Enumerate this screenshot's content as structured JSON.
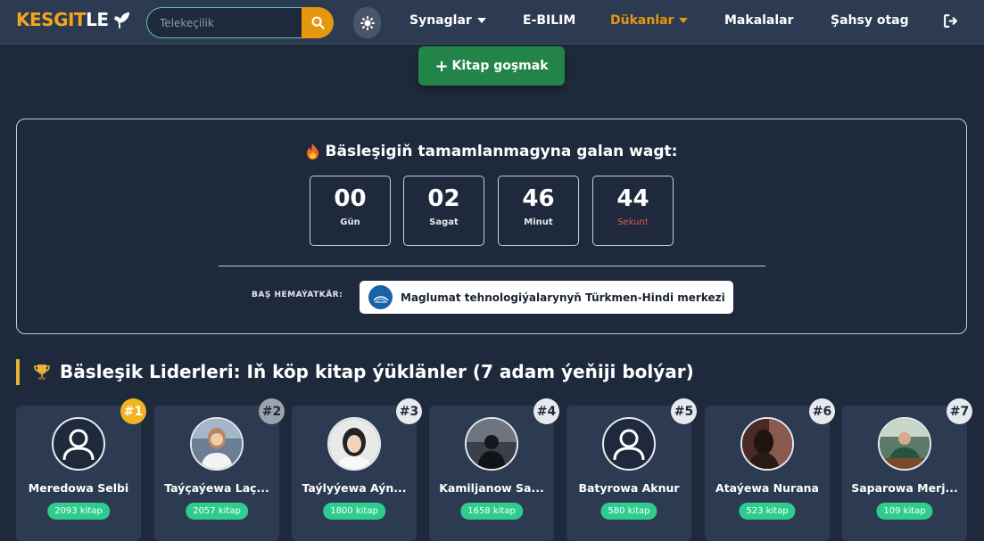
{
  "brand": {
    "part1": "KESGIT",
    "part2": "LE"
  },
  "search": {
    "placeholder": "Telekeçilik"
  },
  "nav": {
    "items": [
      {
        "label": "Synaglar",
        "dropdown": true
      },
      {
        "label": "E-BILIM",
        "dropdown": false
      },
      {
        "label": "Dükanlar",
        "dropdown": true,
        "active": true
      },
      {
        "label": "Makalalar",
        "dropdown": false
      },
      {
        "label": "Şahsy otag",
        "dropdown": false
      }
    ]
  },
  "add_book": {
    "label": "Kitap goşmak"
  },
  "countdown": {
    "title": "Bäsleşigiň tamamlanmagyna galan wagt:",
    "days": {
      "value": "00",
      "unit": "Gün"
    },
    "hours": {
      "value": "02",
      "unit": "Sagat"
    },
    "minutes": {
      "value": "46",
      "unit": "Minut"
    },
    "seconds": {
      "value": "44",
      "unit": "Sekunt"
    }
  },
  "sponsor": {
    "label": "BAŞ HEMAÝATKÄR:",
    "name": "Maglumat tehnologiýalarynyň Türkmen-Hindi merkezi"
  },
  "leaders": {
    "title": "Bäsleşik Liderleri: Iň köp kitap ýüklänler (7 adam ýeňiji bolýar)",
    "cards": [
      {
        "rank": "#1",
        "name": "Meredowa Selbi",
        "count": "2093 kitap",
        "avatar": "default-person"
      },
      {
        "rank": "#2",
        "name": "Taýçaýewa Laç...",
        "count": "2057 kitap",
        "avatar": "photo"
      },
      {
        "rank": "#3",
        "name": "Taýlyýewa Aýn...",
        "count": "1800 kitap",
        "avatar": "photo"
      },
      {
        "rank": "#4",
        "name": "Kamiljanow Sa...",
        "count": "1658 kitap",
        "avatar": "photo"
      },
      {
        "rank": "#5",
        "name": "Batyrowa Aknur",
        "count": "580 kitap",
        "avatar": "default-person"
      },
      {
        "rank": "#6",
        "name": "Ataýewa Nurana",
        "count": "523 kitap",
        "avatar": "photo"
      },
      {
        "rank": "#7",
        "name": "Saparowa Merj...",
        "count": "109 kitap",
        "avatar": "photo"
      }
    ]
  },
  "colors": {
    "accent_orange": "#e7970f",
    "green_button": "#23844a",
    "badge_green": "#2ecc8f",
    "gold": "#f2b321",
    "background": "#1e2a3b",
    "navbar": "#2c3b51"
  }
}
